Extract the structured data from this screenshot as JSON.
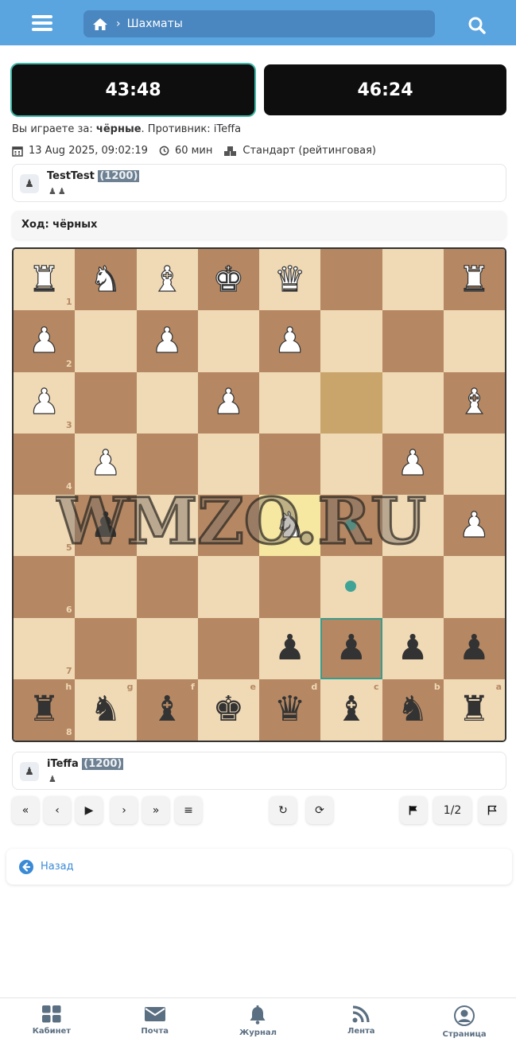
{
  "header": {
    "breadcrumb_current": "Шахматы"
  },
  "clocks": {
    "left": "43:48",
    "right": "46:24"
  },
  "game_info": {
    "playing_as_prefix": "Вы играете за:",
    "playing_as_color": "чёрные",
    "opponent_prefix": ". Противник:",
    "opponent_name": "iTeffa",
    "date": "13 Aug 2025, 09:02:19",
    "time_control": "60 мин",
    "mode": "Стандарт (рейтинговая)"
  },
  "player_top": {
    "name": "TestTest",
    "rating": "(1200)",
    "captured": "♟♟"
  },
  "turn": {
    "text": "Ход: чёрных"
  },
  "board": {
    "orientation": "black",
    "ranks_top_to_bottom": [
      "1",
      "2",
      "3",
      "4",
      "5",
      "6",
      "7",
      "8"
    ],
    "files_left_to_right": [
      "h",
      "g",
      "f",
      "e",
      "d",
      "c",
      "b",
      "a"
    ],
    "position": [
      [
        "wR",
        "wN",
        "wB",
        "wK",
        "wQ",
        "",
        "",
        "wR"
      ],
      [
        "wP",
        "",
        "wP",
        "",
        "wP",
        "",
        "",
        ""
      ],
      [
        "wP",
        "",
        "",
        "wP",
        "",
        "",
        "",
        "wB"
      ],
      [
        "",
        "wP",
        "",
        "",
        "",
        "",
        "wP",
        ""
      ],
      [
        "",
        "bP",
        "",
        "",
        "wN",
        "",
        "",
        "wP"
      ],
      [
        "",
        "",
        "",
        "",
        "",
        "",
        "",
        ""
      ],
      [
        "",
        "",
        "",
        "",
        "bP",
        "bP",
        "bP",
        "bP"
      ],
      [
        "bR",
        "bN",
        "bB",
        "bK",
        "bQ",
        "bB",
        "bN",
        "bR"
      ]
    ],
    "last_move_squares": [
      "d5"
    ],
    "highlight_squares": [
      "c3"
    ],
    "selected_square": "c7",
    "move_dots": [
      "c5",
      "c6"
    ],
    "watermark": "WMZO.RU"
  },
  "player_bottom": {
    "name": "iTeffa",
    "rating": "(1200)",
    "captured": "♟"
  },
  "controls": {
    "first": "«",
    "prev": "‹",
    "play": "▶",
    "next": "›",
    "last": "»",
    "list": "≡",
    "undo": "↻",
    "redo": "⟳",
    "draw": "1/2"
  },
  "back": {
    "label": "Назад"
  },
  "bottom_nav": {
    "items": [
      {
        "label": "Кабинет",
        "icon": "grid-icon"
      },
      {
        "label": "Почта",
        "icon": "mail-icon"
      },
      {
        "label": "Журнал",
        "icon": "bell-icon"
      },
      {
        "label": "Лента",
        "icon": "rss-icon"
      },
      {
        "label": "Страница",
        "icon": "user-icon"
      }
    ]
  },
  "colors": {
    "header_bg": "#5aa5e0",
    "light_square": "#f0d9b5",
    "dark_square": "#b58863",
    "accent": "#3fa396",
    "link": "#3a8ad6"
  }
}
